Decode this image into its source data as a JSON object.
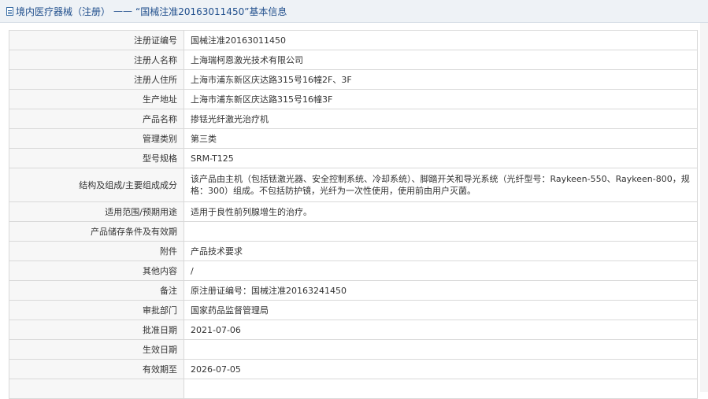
{
  "header": {
    "category": "境内医疗器械（注册）",
    "separator": "——",
    "title": "“国械注准20163011450”基本信息"
  },
  "rows": [
    {
      "label": "注册证编号",
      "value": "国械注准20163011450"
    },
    {
      "label": "注册人名称",
      "value": "上海瑞柯恩激光技术有限公司"
    },
    {
      "label": "注册人住所",
      "value": "上海市浦东新区庆达路315号16幢2F、3F"
    },
    {
      "label": "生产地址",
      "value": "上海市浦东新区庆达路315号16幢3F"
    },
    {
      "label": "产品名称",
      "value": "掺铥光纤激光治疗机"
    },
    {
      "label": "管理类别",
      "value": "第三类"
    },
    {
      "label": "型号规格",
      "value": "SRM-T125"
    },
    {
      "label": "结构及组成/主要组成成分",
      "value": "该产品由主机（包括铥激光器、安全控制系统、冷却系统）、脚踏开关和导光系统（光纤型号：Raykeen-550、Raykeen-800，规格：300）组成。不包括防护镜，光纤为一次性使用，使用前由用户灭菌。"
    },
    {
      "label": "适用范围/预期用途",
      "value": "适用于良性前列腺增生的治疗。"
    },
    {
      "label": "产品储存条件及有效期",
      "value": ""
    },
    {
      "label": "附件",
      "value": "产品技术要求"
    },
    {
      "label": "其他内容",
      "value": "/"
    },
    {
      "label": "备注",
      "value": "原注册证编号：国械注准20163241450"
    },
    {
      "label": "审批部门",
      "value": "国家药品监督管理局"
    },
    {
      "label": "批准日期",
      "value": "2021-07-06"
    },
    {
      "label": "生效日期",
      "value": ""
    },
    {
      "label": "有效期至",
      "value": "2026-07-05"
    },
    {
      "label": "",
      "value": ""
    }
  ]
}
